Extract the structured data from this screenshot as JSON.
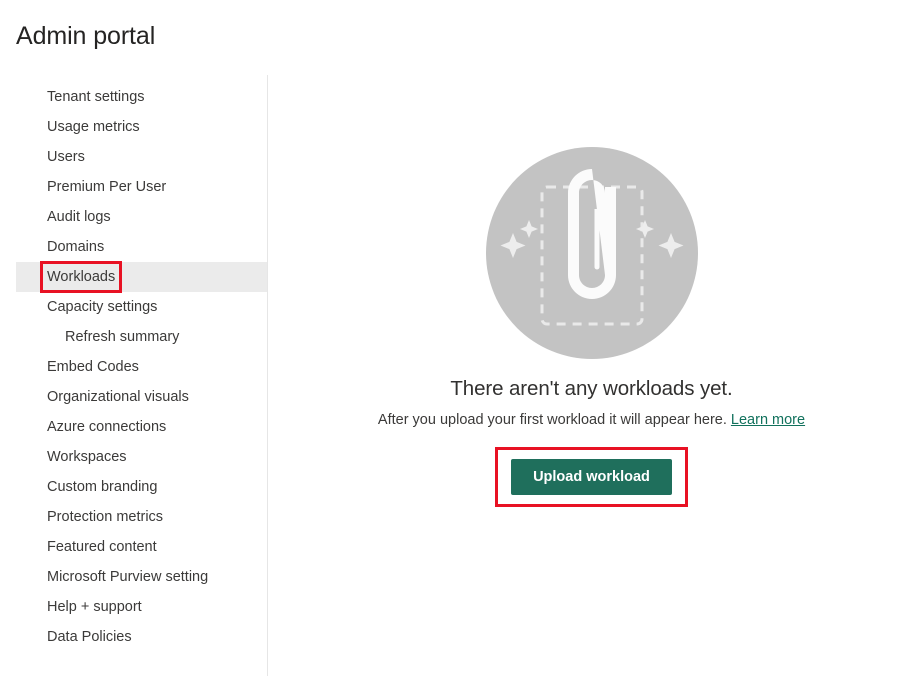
{
  "header": {
    "title": "Admin portal"
  },
  "sidebar": {
    "items": [
      {
        "label": "Tenant settings",
        "selected": false,
        "sub": false,
        "annotated": false
      },
      {
        "label": "Usage metrics",
        "selected": false,
        "sub": false,
        "annotated": false
      },
      {
        "label": "Users",
        "selected": false,
        "sub": false,
        "annotated": false
      },
      {
        "label": "Premium Per User",
        "selected": false,
        "sub": false,
        "annotated": false
      },
      {
        "label": "Audit logs",
        "selected": false,
        "sub": false,
        "annotated": false
      },
      {
        "label": "Domains",
        "selected": false,
        "sub": false,
        "annotated": false
      },
      {
        "label": "Workloads",
        "selected": true,
        "sub": false,
        "annotated": true
      },
      {
        "label": "Capacity settings",
        "selected": false,
        "sub": false,
        "annotated": false
      },
      {
        "label": "Refresh summary",
        "selected": false,
        "sub": true,
        "annotated": false
      },
      {
        "label": "Embed Codes",
        "selected": false,
        "sub": false,
        "annotated": false
      },
      {
        "label": "Organizational visuals",
        "selected": false,
        "sub": false,
        "annotated": false
      },
      {
        "label": "Azure connections",
        "selected": false,
        "sub": false,
        "annotated": false
      },
      {
        "label": "Workspaces",
        "selected": false,
        "sub": false,
        "annotated": false
      },
      {
        "label": "Custom branding",
        "selected": false,
        "sub": false,
        "annotated": false
      },
      {
        "label": "Protection metrics",
        "selected": false,
        "sub": false,
        "annotated": false
      },
      {
        "label": "Featured content",
        "selected": false,
        "sub": false,
        "annotated": false
      },
      {
        "label": "Microsoft Purview setting",
        "selected": false,
        "sub": false,
        "annotated": false
      },
      {
        "label": "Help + support",
        "selected": false,
        "sub": false,
        "annotated": false
      },
      {
        "label": "Data Policies",
        "selected": false,
        "sub": false,
        "annotated": false
      }
    ]
  },
  "main": {
    "illustration": {
      "icon_name": "paperclip-upload-illustration",
      "circle_color": "#c3c3c3",
      "clip_color": "#fbfbfb",
      "dashed_box_color": "#e8e8e8"
    },
    "heading": "There aren't any workloads yet.",
    "subtitle_prefix": "After you upload your first workload it will appear here.",
    "learn_more_label": "Learn more",
    "upload_button_label": "Upload workload"
  },
  "colors": {
    "accent_green": "#1f6f5c",
    "link_green": "#11715c",
    "annotation_red": "#e81123",
    "selected_row": "#ebebeb",
    "divider": "#e6e6e6"
  }
}
